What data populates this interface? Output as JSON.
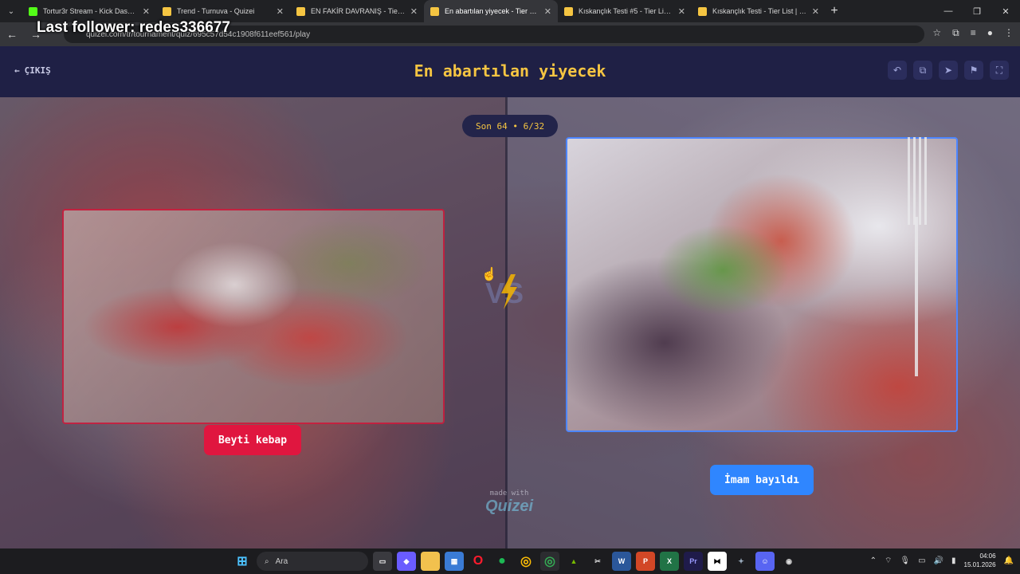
{
  "browser": {
    "tabs": [
      {
        "title": "Tortur3r Stream - Kick Dashbo",
        "fav": "#53fc18",
        "active": false
      },
      {
        "title": "Trend - Turnuva - Quizei",
        "fav": "#f5c542",
        "active": false
      },
      {
        "title": "EN FAKİR DAVRANIŞ - Tier List",
        "fav": "#f5c542",
        "active": false
      },
      {
        "title": "En abartılan yiyecek - Tier List, T",
        "fav": "#f5c542",
        "active": true
      },
      {
        "title": "Kıskançlık Testi #5 - Tier List | K",
        "fav": "#f5c542",
        "active": false
      },
      {
        "title": "Kıskançlık Testi - Tier List | Kör S",
        "fav": "#f5c542",
        "active": false
      }
    ],
    "url": "quizei.com/tr/tournament/quiz/695c57d54c1908f611eef561/play"
  },
  "overlay_text": "Last follower: redes336677",
  "app": {
    "exit_label": "ÇIKIŞ",
    "title": "En abartılan yiyecek",
    "round_badge": "Son 64 • 6/32",
    "left_option": "Beyti kebap",
    "right_option": "İmam bayıldı",
    "vs_text": "VS",
    "made_with": "made with",
    "brand": "Quizei",
    "colors": {
      "accent": "#f5c542",
      "left": "#e0163f",
      "right": "#2f86ff",
      "header": "#1f2045"
    }
  },
  "taskbar": {
    "search_placeholder": "Ara",
    "time": "04:06",
    "date": "15.01.2026"
  }
}
